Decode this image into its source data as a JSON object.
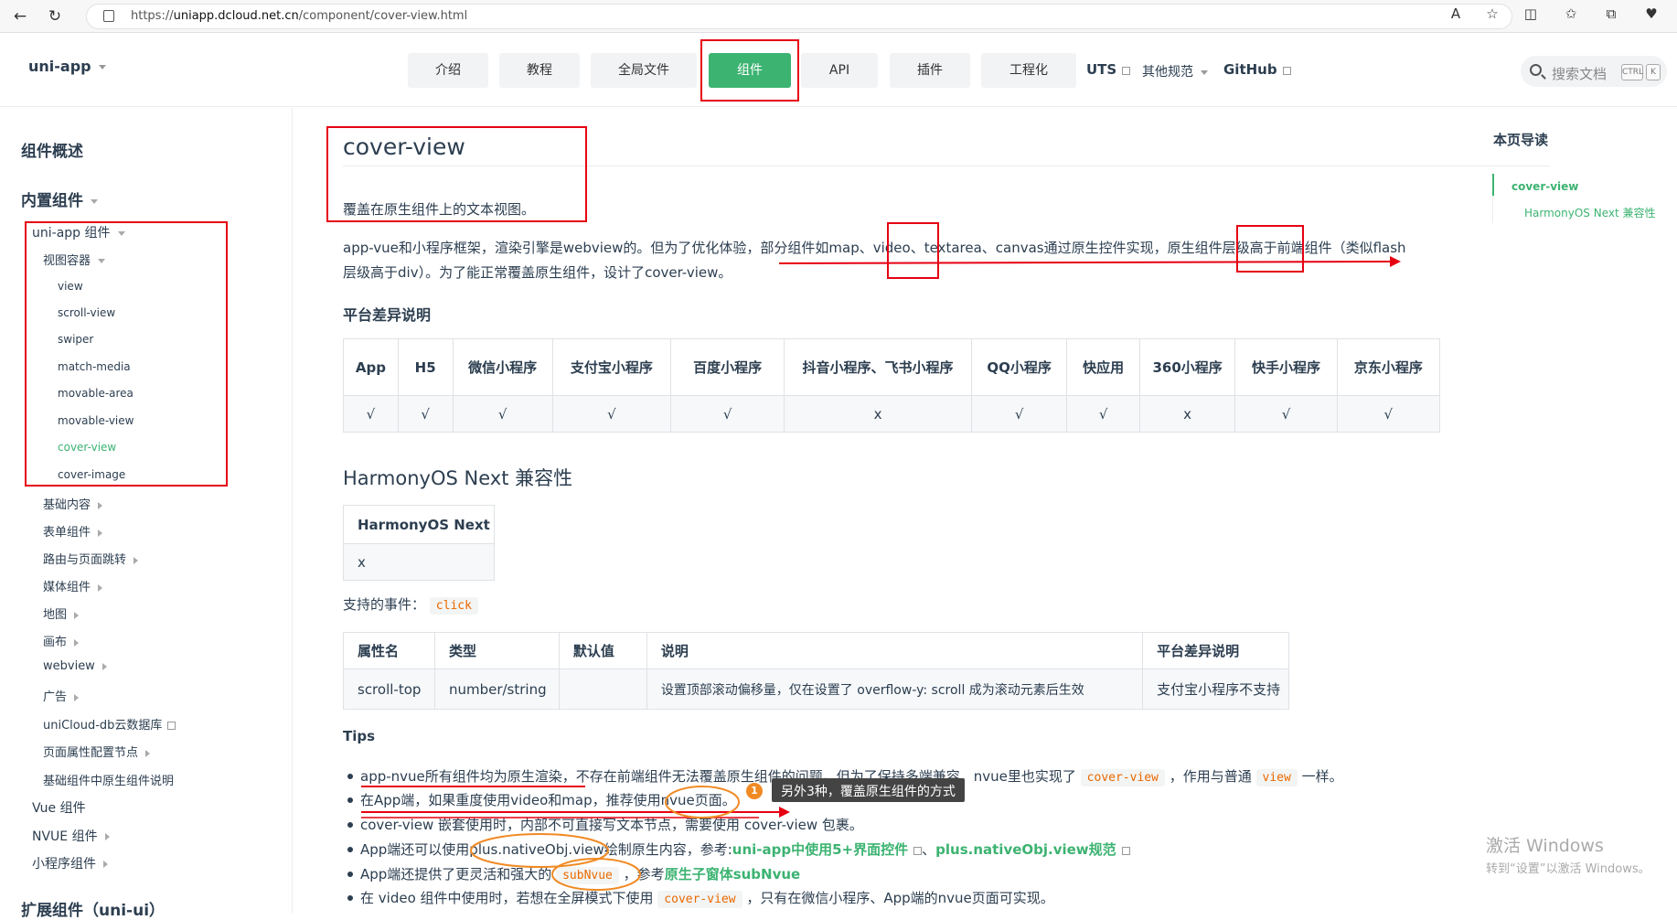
{
  "browser": {
    "url_prefix": "https://",
    "url_host": "uniapp.dcloud.net.cn",
    "url_path": "/component/cover-view.html"
  },
  "header": {
    "brand": "uni-app",
    "nav": [
      "介绍",
      "教程",
      "全局文件",
      "组件",
      "API",
      "插件",
      "工程化"
    ],
    "links": [
      "UTS",
      "其他规范",
      "GitHub"
    ],
    "search_placeholder": "搜索文档",
    "kbd": [
      "CTRL",
      "K"
    ]
  },
  "sidebar": {
    "overview": "组件概述",
    "builtin": "内置组件",
    "uniapp_group": "uni-app 组件",
    "view_container": "视图容器",
    "view_items": [
      "view",
      "scroll-view",
      "swiper",
      "match-media",
      "movable-area",
      "movable-view",
      "cover-view",
      "cover-image"
    ],
    "groups": [
      "基础内容",
      "表单组件",
      "路由与页面跳转",
      "媒体组件",
      "地图",
      "画布",
      "webview",
      "广告",
      "uniCloud-db云数据库",
      "页面属性配置节点",
      "基础组件中原生组件说明"
    ],
    "vue": "Vue 组件",
    "nvue": "NVUE 组件",
    "mp": "小程序组件",
    "ext": "扩展组件（uni-ui）"
  },
  "main": {
    "title": "cover-view",
    "intro": "覆盖在原生组件上的文本视图。",
    "para1": "app-vue和小程序框架，渲染引擎是webview的。但为了优化体验，部分组件如map、video、textarea、canvas通过原生控件实现，原生组件层级高于前端组件（类似flash",
    "para2": "层级高于div）。为了能正常覆盖原生组件，设计了cover-view。",
    "platform_heading": "平台差异说明",
    "platform_table": {
      "headers": [
        "App",
        "H5",
        "微信小程序",
        "支付宝小程序",
        "百度小程序",
        "抖音小程序、飞书小程序",
        "QQ小程序",
        "快应用",
        "360小程序",
        "快手小程序",
        "京东小程序"
      ],
      "values": [
        "√",
        "√",
        "√",
        "√",
        "√",
        "x",
        "√",
        "√",
        "x",
        "√",
        "√"
      ]
    },
    "harmony_heading": "HarmonyOS Next 兼容性",
    "harmony_table": {
      "header": "HarmonyOS Next",
      "value": "x"
    },
    "events_label": "支持的事件：",
    "events_code": "click",
    "attr_table": {
      "headers": [
        "属性名",
        "类型",
        "默认值",
        "说明",
        "平台差异说明"
      ],
      "row": [
        "scroll-top",
        "number/string",
        "",
        "设置顶部滚动偏移量，仅在设置了 overflow-y: scroll 成为滚动元素后生效",
        "支付宝小程序不支持"
      ]
    },
    "tips_heading": "Tips",
    "tip1_a": "app-nvue所有组件均为原生渲染，不存在前端组件无法覆盖原生组件的问题。但为了保持多端兼容，nvue里也实现了",
    "tip1_code1": "cover-view",
    "tip1_b": "，作用与普通",
    "tip1_code2": "view",
    "tip1_c": "一样。",
    "tip2": "在App端，如果重度使用video和map，推荐使用nvue页面。",
    "tip3": "cover-view 嵌套使用时，内部不可直接写文本节点，需要使用 cover-view 包裹。",
    "tip4_a": "App端还可以使用plus.nativeObj.view绘制原生内容，参考:",
    "tip4_link1": "uni-app中使用5+界面控件",
    "tip4_sep": "、",
    "tip4_link2": "plus.nativeObj.view规范",
    "tip5_a": "App端还提供了更灵活和强大的",
    "tip5_code": "subNvue",
    "tip5_b": "，参考",
    "tip5_link": "原生子窗体subNvue",
    "tip6_a": "在 video 组件中使用时，若想在全屏模式下使用",
    "tip6_code": "cover-view",
    "tip6_b": "，只有在微信小程序、App端的nvue页面可实现。",
    "annotation_num": "1",
    "annotation": "另外3种，覆盖原生组件的方式"
  },
  "toc": {
    "title": "本页导读",
    "items": [
      "cover-view",
      "HarmonyOS Next 兼容性"
    ]
  },
  "watermark": {
    "line1": "激活 Windows",
    "line2": "转到“设置”以激活 Windows。"
  },
  "colors": {
    "accent": "#3cb371",
    "annotation_red": "#e60012",
    "annotation_orange": "#f08a24"
  }
}
